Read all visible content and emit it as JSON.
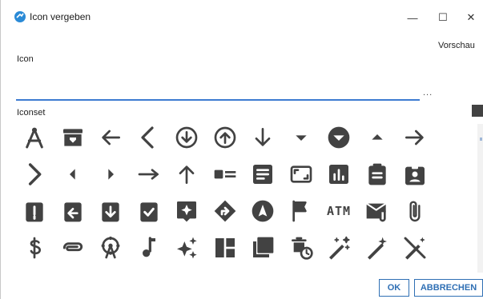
{
  "window": {
    "title": "Icon vergeben",
    "minimize": "—",
    "maximize": "☐",
    "close": "✕"
  },
  "fields": {
    "icon_label": "Icon",
    "icon_value": "",
    "ellipsis": "...",
    "preview_label": "Vorschau",
    "iconset_label": "Iconset"
  },
  "icons": [
    [
      "compass-icon",
      "archive-icon",
      "arrow-left-icon",
      "chevron-left-icon",
      "arrow-circle-down-icon",
      "arrow-circle-up-icon",
      "arrow-down-icon",
      "caret-down-icon",
      "chevron-circle-down-icon",
      "caret-up-icon",
      "arrow-right-icon"
    ],
    [
      "chevron-right-icon",
      "caret-left-icon",
      "caret-right-icon",
      "arrow-right-long-icon",
      "arrow-up-icon",
      "image-list-icon",
      "article-icon",
      "aspect-ratio-icon",
      "bar-chart-icon",
      "clipboard-icon",
      "badge-icon"
    ],
    [
      "clipboard-alert-icon",
      "clipboard-arrow-left-icon",
      "clipboard-arrow-down-icon",
      "clipboard-check-icon",
      "assistant-icon",
      "directions-icon",
      "navigation-icon",
      "flag-icon",
      "atm-icon",
      "attach-email-icon",
      "attach-file-icon"
    ],
    [
      "dollar-icon",
      "attachment-icon",
      "ferris-wheel-icon",
      "music-note-icon",
      "auto-awesome-icon",
      "dashboard-icon",
      "library-icon",
      "delete-clock-icon",
      "auto-fix-icon",
      "magic-wand-icon",
      "auto-fix-off-icon"
    ]
  ],
  "atm_text": "ATM",
  "colors": {
    "accent": "#3d7bd1",
    "icon": "#424242",
    "button": "#2f6fb4"
  },
  "buttons": {
    "ok": "OK",
    "cancel": "ABBRECHEN"
  }
}
